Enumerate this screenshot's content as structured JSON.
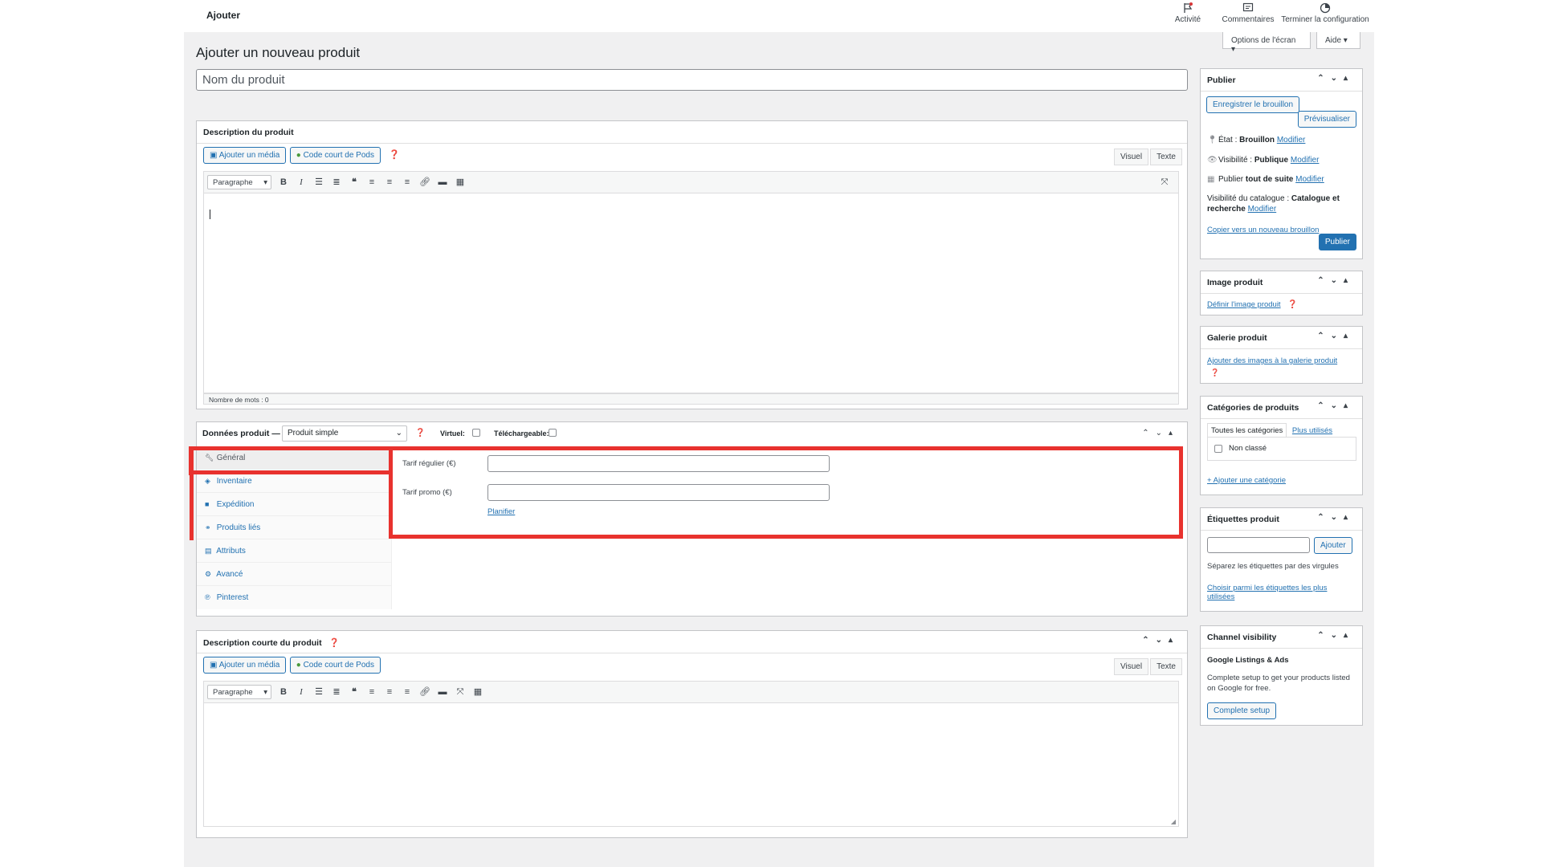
{
  "topbar": {
    "title": "Ajouter",
    "items": [
      {
        "label": "Activité",
        "icon": "flag-icon"
      },
      {
        "label": "Commentaires",
        "icon": "comments-icon"
      },
      {
        "label": "Terminer la configuration",
        "icon": "progress-icon"
      }
    ],
    "screen_options": "Options de l'écran ▾",
    "help": "Aide ▾"
  },
  "page": {
    "title": "Ajouter un nouveau produit",
    "name_placeholder": "Nom du produit"
  },
  "description": {
    "title": "Description du produit",
    "add_media": "Ajouter un média",
    "pods_shortcode": "Code court de Pods",
    "tab_visual": "Visuel",
    "tab_text": "Texte",
    "format": "Paragraphe",
    "word_count": "Nombre de mots : 0"
  },
  "product_data": {
    "title": "Données produit —",
    "type": "Produit simple",
    "virtual_label": "Virtuel:",
    "downloadable_label": "Téléchargeable:",
    "nav": [
      {
        "label": "Général",
        "icon": "wrench-icon"
      },
      {
        "label": "Inventaire",
        "icon": "tag-icon"
      },
      {
        "label": "Expédition",
        "icon": "truck-icon"
      },
      {
        "label": "Produits liés",
        "icon": "link-icon"
      },
      {
        "label": "Attributs",
        "icon": "list-icon"
      },
      {
        "label": "Avancé",
        "icon": "gear-icon"
      },
      {
        "label": "Pinterest",
        "icon": "pinterest-icon"
      }
    ],
    "regular_price_label": "Tarif régulier (€)",
    "sale_price_label": "Tarif promo (€)",
    "schedule": "Planifier"
  },
  "short_description": {
    "title": "Description courte du produit",
    "add_media": "Ajouter un média",
    "pods_shortcode": "Code court de Pods",
    "tab_visual": "Visuel",
    "tab_text": "Texte",
    "format": "Paragraphe"
  },
  "publish": {
    "title": "Publier",
    "save_draft": "Enregistrer le brouillon",
    "preview": "Prévisualiser",
    "status_label": "État :",
    "status_value": "Brouillon",
    "visibility_label": "Visibilité :",
    "visibility_value": "Publique",
    "publish_label": "Publier",
    "publish_value": "tout de suite",
    "edit": "Modifier",
    "catalog_label": "Visibilité du catalogue :",
    "catalog_value": "Catalogue et recherche",
    "copy_draft": "Copier vers un nouveau brouillon",
    "publish_button": "Publier"
  },
  "image": {
    "title": "Image produit",
    "set": "Définir l'image produit"
  },
  "gallery": {
    "title": "Galerie produit",
    "add": "Ajouter des images à la galerie produit"
  },
  "categories": {
    "title": "Catégories de produits",
    "tab_all": "Toutes les catégories",
    "tab_most": "Plus utilisés",
    "uncategorized": "Non classé",
    "add": "+ Ajouter une catégorie"
  },
  "tags": {
    "title": "Étiquettes produit",
    "add_button": "Ajouter",
    "hint": "Séparez les étiquettes par des virgules",
    "choose": "Choisir parmi les étiquettes les plus utilisées"
  },
  "channel": {
    "title": "Channel visibility",
    "name": "Google Listings & Ads",
    "text": "Complete setup to get your products listed on Google for free.",
    "button": "Complete setup"
  },
  "colors": {
    "accent": "#2271b1",
    "highlight": "#e8322e",
    "background": "#f0f0f1"
  }
}
